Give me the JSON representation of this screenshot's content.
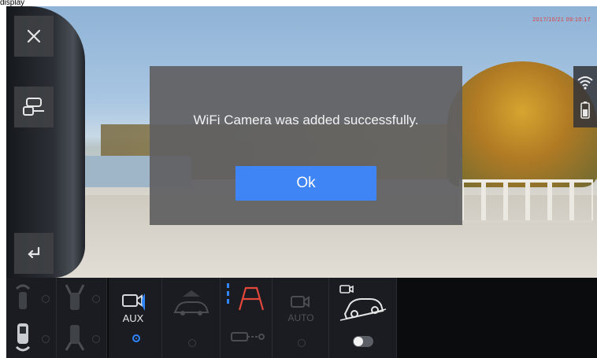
{
  "top_label": "display",
  "camera": {
    "timestamp": "2017/10/21 09:10:17"
  },
  "dialog": {
    "message": "WiFi Camera was added successfully.",
    "ok_label": "Ok"
  },
  "bottom_bar": {
    "aux_label": "AUX",
    "auto_label": "AUTO",
    "toggle_on": false
  },
  "colors": {
    "accent": "#3f85f5",
    "aux_blue": "#2f86ff",
    "rear_red": "#e2473c",
    "dialog_bg": "#606062"
  },
  "icons": {
    "close": "close-icon",
    "mirror": "rear-view-mirror-icon",
    "back": "return-arrow-icon",
    "wifi": "wifi-icon",
    "battery": "battery-icon"
  }
}
